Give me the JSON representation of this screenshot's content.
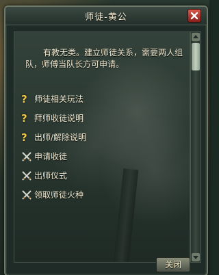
{
  "dialog": {
    "title": "师徒-黄公",
    "intro": "有教无类。建立师徒关系，需要两人组队，师傅当队长方可申请。",
    "close_button_label": "关闭"
  },
  "menu": {
    "items": [
      {
        "label": "师徒相关玩法",
        "icon": "question-icon"
      },
      {
        "label": "拜师收徒说明",
        "icon": "question-icon"
      },
      {
        "label": "出师/解除说明",
        "icon": "question-icon"
      },
      {
        "label": "申请收徒",
        "icon": "crossed-swords-icon"
      },
      {
        "label": "出师仪式",
        "icon": "crossed-swords-icon"
      },
      {
        "label": "领取师徒火种",
        "icon": "crossed-swords-icon"
      }
    ]
  },
  "colors": {
    "text": "#f1ead2",
    "question_icon": "#f0c84a",
    "close_button": "#b3362c"
  }
}
